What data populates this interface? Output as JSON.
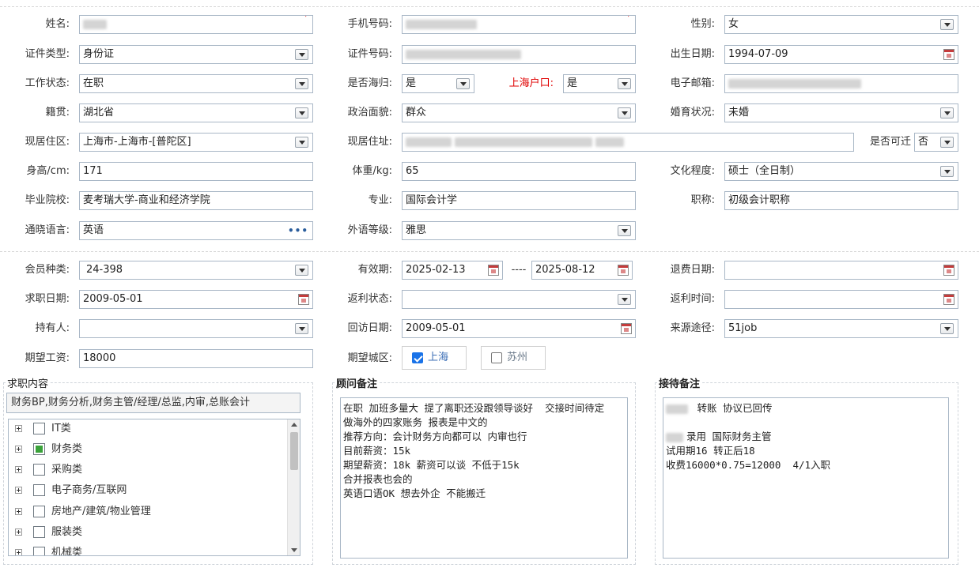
{
  "form": {
    "name_label": "姓名:",
    "phone_label": "手机号码:",
    "gender_label": "性别:",
    "gender_value": "女",
    "idtype_label": "证件类型:",
    "idtype_value": "身份证",
    "idnum_label": "证件号码:",
    "birth_label": "出生日期:",
    "birth_value": "1994-07-09",
    "workstatus_label": "工作状态:",
    "workstatus_value": "在职",
    "returnee_label": "是否海归:",
    "returnee_value": "是",
    "shhukou_label": "上海户口:",
    "shhukou_value": "是",
    "email_label": "电子邮箱:",
    "origin_label": "籍贯:",
    "origin_value": "湖北省",
    "political_label": "政治面貌:",
    "political_value": "群众",
    "marital_label": "婚育状况:",
    "marital_value": "未婚",
    "residence_area_label": "现居住区:",
    "residence_area_value": "上海市-上海市-[普陀区]",
    "address_label": "现居住址:",
    "relocate_label": "是否可迁",
    "relocate_value": "否",
    "height_label": "身高/cm:",
    "height_value": "171",
    "weight_label": "体重/kg:",
    "weight_value": "65",
    "education_label": "文化程度:",
    "education_value": "硕士（全日制）",
    "school_label": "毕业院校:",
    "school_value": "麦考瑞大学-商业和经济学院",
    "major_label": "专业:",
    "major_value": "国际会计学",
    "title_label": "职称:",
    "title_value": "初级会计职称",
    "language_label": "通晓语言:",
    "language_value": "英语",
    "language_more": "•••",
    "foreign_level_label": "外语等级:",
    "foreign_level_value": "雅思",
    "member_type_label": "会员种类:",
    "member_type_value": "24-398",
    "valid_label": "有效期:",
    "valid_from": "2025-02-13",
    "valid_sep": "----",
    "valid_to": "2025-08-12",
    "refund_date_label": "退费日期:",
    "jobhunt_date_label": "求职日期:",
    "jobhunt_date_value": "2009-05-01",
    "rebate_status_label": "返利状态:",
    "rebate_time_label": "返利时间:",
    "holder_label": "持有人:",
    "revisit_date_label": "回访日期:",
    "revisit_date_value": "2009-05-01",
    "source_label": "来源途径:",
    "source_value": "51job",
    "salary_label": "期望工资:",
    "salary_value": "18000",
    "city_label": "期望城区:",
    "city_shanghai": "上海",
    "city_suzhou": "苏州",
    "required_mark": "*"
  },
  "job": {
    "legend": "求职内容",
    "selected": "财务BP,财务分析,财务主管/经理/总监,内审,总账会计",
    "tree": [
      "IT类",
      "财务类",
      "采购类",
      "电子商务/互联网",
      "房地产/建筑/物业管理",
      "服装类",
      "机械类"
    ]
  },
  "consultant": {
    "legend": "顾问备注",
    "text": "在职 加班多量大 提了离职还没跟领导谈好  交接时间待定\n做海外的四家账务 报表是中文的\n推荐方向：会计财务方向都可以 内审也行\n目前薪资：15k\n期望薪资：18k 薪资可以谈 不低于15k\n合并报表也会的\n英语口语OK 想去外企 不能搬迁"
  },
  "reception": {
    "legend": "接待备注",
    "line1": "转账 协议已回传",
    "line2": "录用 国际财务主管",
    "line3": "试用期16 转正后18",
    "line4": "收费16000*0.75=12000  4/1入职"
  }
}
